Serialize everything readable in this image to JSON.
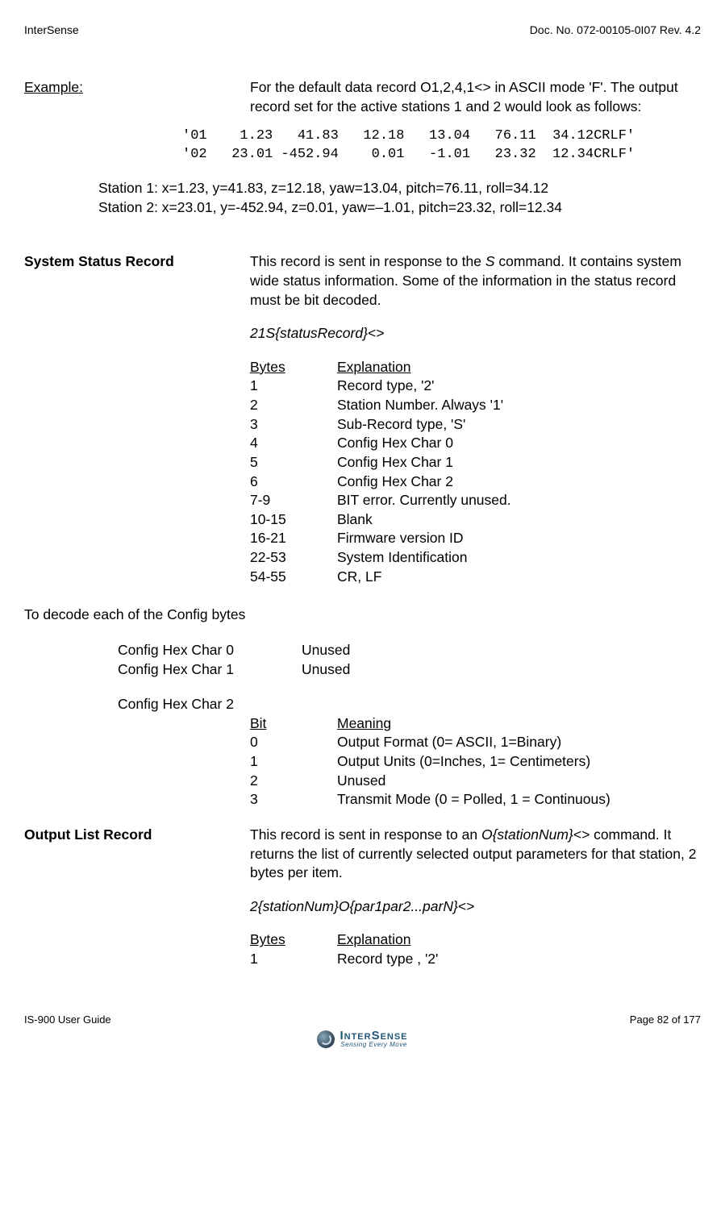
{
  "header": {
    "left": "InterSense",
    "right": "Doc. No. 072-00105-0I07 Rev. 4.2"
  },
  "example": {
    "label": "Example:",
    "intro": "For the default data record O1,2,4,1<> in ASCII mode 'F'. The output record set for the active stations 1 and 2 would look as follows:",
    "mono1": "'01    1.23   41.83   12.18   13.04   76.11  34.12CRLF'",
    "mono2": "'02   23.01 -452.94    0.01   -1.01   23.32  12.34CRLF'",
    "station1": "Station 1: x=1.23,   y=41.83,    z=12.18,   yaw=13.04,   pitch=76.11, roll=34.12",
    "station2": "Station 2: x=23.01, y=-452.94, z=0.01,    yaw=–1.01,    pitch=23.32, roll=12.34"
  },
  "system_status": {
    "label": "System Status Record",
    "intro_pre": "This record is sent in response to the ",
    "intro_cmd": "S",
    "intro_post": " command.  It contains system wide status information.  Some of the information in the status record must be bit decoded.",
    "format": "21S{statusRecord}<>",
    "hdr_a": "Bytes",
    "hdr_b": "Explanation",
    "rows": [
      {
        "a": "1",
        "b": "Record type, '2'"
      },
      {
        "a": "2",
        "b": "Station Number. Always '1'"
      },
      {
        "a": "3",
        "b": "Sub-Record type, 'S'"
      },
      {
        "a": "4",
        "b": "Config Hex Char 0"
      },
      {
        "a": "5",
        "b": "Config Hex Char 1"
      },
      {
        "a": "6",
        "b": "Config Hex Char 2"
      },
      {
        "a": "7-9",
        "b": "BIT error. Currently unused."
      },
      {
        "a": "10-15",
        "b": "Blank"
      },
      {
        "a": "16-21",
        "b": "Firmware version ID"
      },
      {
        "a": "22-53",
        "b": "System Identification"
      },
      {
        "a": "54-55",
        "b": "CR, LF"
      }
    ]
  },
  "decode": {
    "title": "To decode each of the Config bytes",
    "c0_a": "Config Hex Char 0",
    "c0_b": "Unused",
    "c1_a": "Config Hex Char 1",
    "c1_b": "Unused",
    "c2": "Config Hex Char 2",
    "hdr_a": "Bit",
    "hdr_b": "Meaning",
    "rows": [
      {
        "a": "0",
        "b": "Output Format (0= ASCII, 1=Binary)"
      },
      {
        "a": "1",
        "b": "Output Units (0=Inches, 1= Centimeters)"
      },
      {
        "a": "2",
        "b": "Unused"
      },
      {
        "a": "3",
        "b": "Transmit Mode (0 = Polled, 1 = Continuous)"
      }
    ]
  },
  "output_list": {
    "label": "Output List Record",
    "intro_pre": "This record is sent in response to an ",
    "intro_cmd": "O{stationNum}<>",
    "intro_post": " command. It returns the list of currently selected output parameters for that station, 2 bytes per item.",
    "format": "2{stationNum}O{par1par2...parN}<>",
    "hdr_a": "Bytes",
    "hdr_b": "Explanation",
    "rows": [
      {
        "a": "1",
        "b": "Record type , '2'"
      }
    ]
  },
  "footer": {
    "left": "IS-900 User Guide",
    "right": "Page 82 of 177"
  },
  "logo": {
    "main": "InterSense",
    "sub": "Sensing Every Move"
  }
}
